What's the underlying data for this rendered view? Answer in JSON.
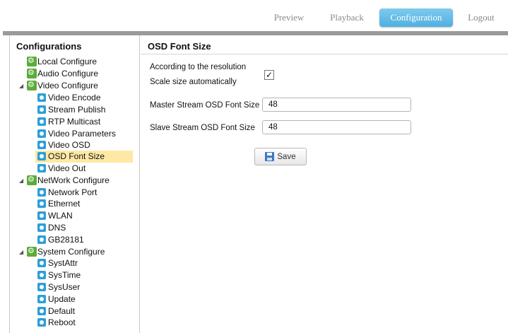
{
  "topnav": {
    "preview": "Preview",
    "playback": "Playback",
    "configuration": "Configuration",
    "logout": "Logout"
  },
  "sidebar": {
    "title": "Configurations",
    "items": [
      {
        "label": "Local Configure",
        "icon": "config-group-icon"
      },
      {
        "label": "Audio Configure",
        "icon": "config-group-icon"
      },
      {
        "label": "Video Configure",
        "icon": "config-group-icon",
        "expanded": true
      },
      {
        "label": "Video Encode",
        "icon": "config-item-icon"
      },
      {
        "label": "Stream Publish",
        "icon": "config-item-icon"
      },
      {
        "label": "RTP Multicast",
        "icon": "config-item-icon"
      },
      {
        "label": "Video Parameters",
        "icon": "config-item-icon"
      },
      {
        "label": "Video OSD",
        "icon": "config-item-icon"
      },
      {
        "label": "OSD Font Size",
        "icon": "config-item-icon",
        "selected": true
      },
      {
        "label": "Video Out",
        "icon": "config-item-icon"
      },
      {
        "label": "NetWork Configure",
        "icon": "config-group-icon",
        "expanded": true
      },
      {
        "label": "Network Port",
        "icon": "config-item-icon"
      },
      {
        "label": "Ethernet",
        "icon": "config-item-icon"
      },
      {
        "label": "WLAN",
        "icon": "config-item-icon"
      },
      {
        "label": "DNS",
        "icon": "config-item-icon"
      },
      {
        "label": "GB28181",
        "icon": "config-item-icon"
      },
      {
        "label": "System Configure",
        "icon": "config-group-icon",
        "expanded": true
      },
      {
        "label": "SystAttr",
        "icon": "config-item-icon"
      },
      {
        "label": "SysTime",
        "icon": "config-item-icon"
      },
      {
        "label": "SysUser",
        "icon": "config-item-icon"
      },
      {
        "label": "Update",
        "icon": "config-item-icon"
      },
      {
        "label": "Default",
        "icon": "config-item-icon"
      },
      {
        "label": "Reboot",
        "icon": "config-item-icon"
      }
    ]
  },
  "content": {
    "title": "OSD Font Size",
    "resolution_label_1": "According to the resolution",
    "resolution_label_2": "Scale size automatically",
    "auto_scale_checked": true,
    "checkmark": "✓",
    "master_label": "Master Stream OSD Font Size",
    "master_value": "48",
    "slave_label": "Slave Stream OSD Font Size",
    "slave_value": "48",
    "save_label": "Save"
  },
  "colors": {
    "accent": "#5bb8e4",
    "selected_row": "#ffe8a5",
    "group_icon": "#5dab3a",
    "item_icon": "#2d9fd9"
  }
}
